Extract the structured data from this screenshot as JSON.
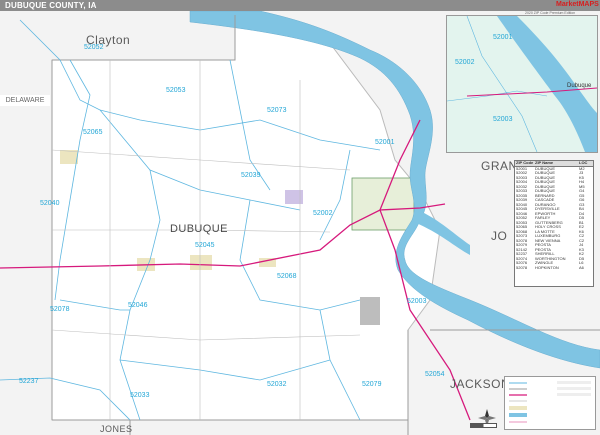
{
  "title": "DUBUQUE COUNTY, IA",
  "edition": "2020 ZIP Code Premium Edition",
  "logo": {
    "text": "MarketMAPS",
    "sub": "Red Bridge"
  },
  "counties": {
    "main": "DUBUQUE",
    "neighbors": [
      {
        "id": "clayton",
        "label": "Clayton"
      },
      {
        "id": "delaware",
        "label": "DELAWARE"
      },
      {
        "id": "grant",
        "label": "GRAN"
      },
      {
        "id": "jo",
        "label": "JO"
      },
      {
        "id": "jackson",
        "label": "JACKSON"
      },
      {
        "id": "jones",
        "label": "JONES"
      }
    ]
  },
  "zip_labels": [
    "52052",
    "52053",
    "52073",
    "52001",
    "52065",
    "52039",
    "52040",
    "52002",
    "52045",
    "52068",
    "52046",
    "52078",
    "52003",
    "52237",
    "52033",
    "52032",
    "52079",
    "52054"
  ],
  "inset": {
    "zips": [
      "52001",
      "52002",
      "52003"
    ],
    "city": "Dubuque"
  },
  "zip_table": {
    "headers": [
      "ZIP Code",
      "ZIP Name",
      "LOC"
    ],
    "rows": [
      [
        "52001",
        "DUBUQUE",
        "M2"
      ],
      [
        "52002",
        "DUBUQUE",
        "J3"
      ],
      [
        "52003",
        "DUBUQUE",
        "K5"
      ],
      [
        "52004",
        "DUBUQUE",
        "H4"
      ],
      [
        "52032",
        "DUBUQUE",
        "M5"
      ],
      [
        "52033",
        "DUBUQUE",
        "G4"
      ],
      [
        "52035",
        "BERNARD",
        "G5"
      ],
      [
        "52039",
        "CASCADE",
        "G6"
      ],
      [
        "52040",
        "DURANGO",
        "G3"
      ],
      [
        "52045",
        "DYERSVILLE",
        "B4"
      ],
      [
        "52046",
        "EPWORTH",
        "D4"
      ],
      [
        "52052",
        "FARLEY",
        "D5"
      ],
      [
        "52053",
        "GUTTENBERG",
        "B1"
      ],
      [
        "52065",
        "HOLY CROSS",
        "E2"
      ],
      [
        "52068",
        "LA MOTTE",
        "K6"
      ],
      [
        "52073",
        "LUXEMBURG",
        "C2"
      ],
      [
        "52078",
        "NEW VIENNA",
        "C2"
      ],
      [
        "52079",
        "PEOSTA",
        "J4"
      ],
      [
        "52142",
        "PEOSTA",
        "K3"
      ],
      [
        "52237",
        "SHERRILL",
        "K2"
      ],
      [
        "52074",
        "WORTHINGTON",
        "D5"
      ],
      [
        "52076",
        "ZWINGLE",
        "L6"
      ],
      [
        "52078",
        "HOPKINTON",
        "A6"
      ]
    ]
  },
  "colors": {
    "water": "#7fc4e3",
    "zip_line": "#5fb7e0",
    "highway": "#d6197c",
    "urban": "#ede9c5",
    "county_line": "#aaaaaa"
  }
}
